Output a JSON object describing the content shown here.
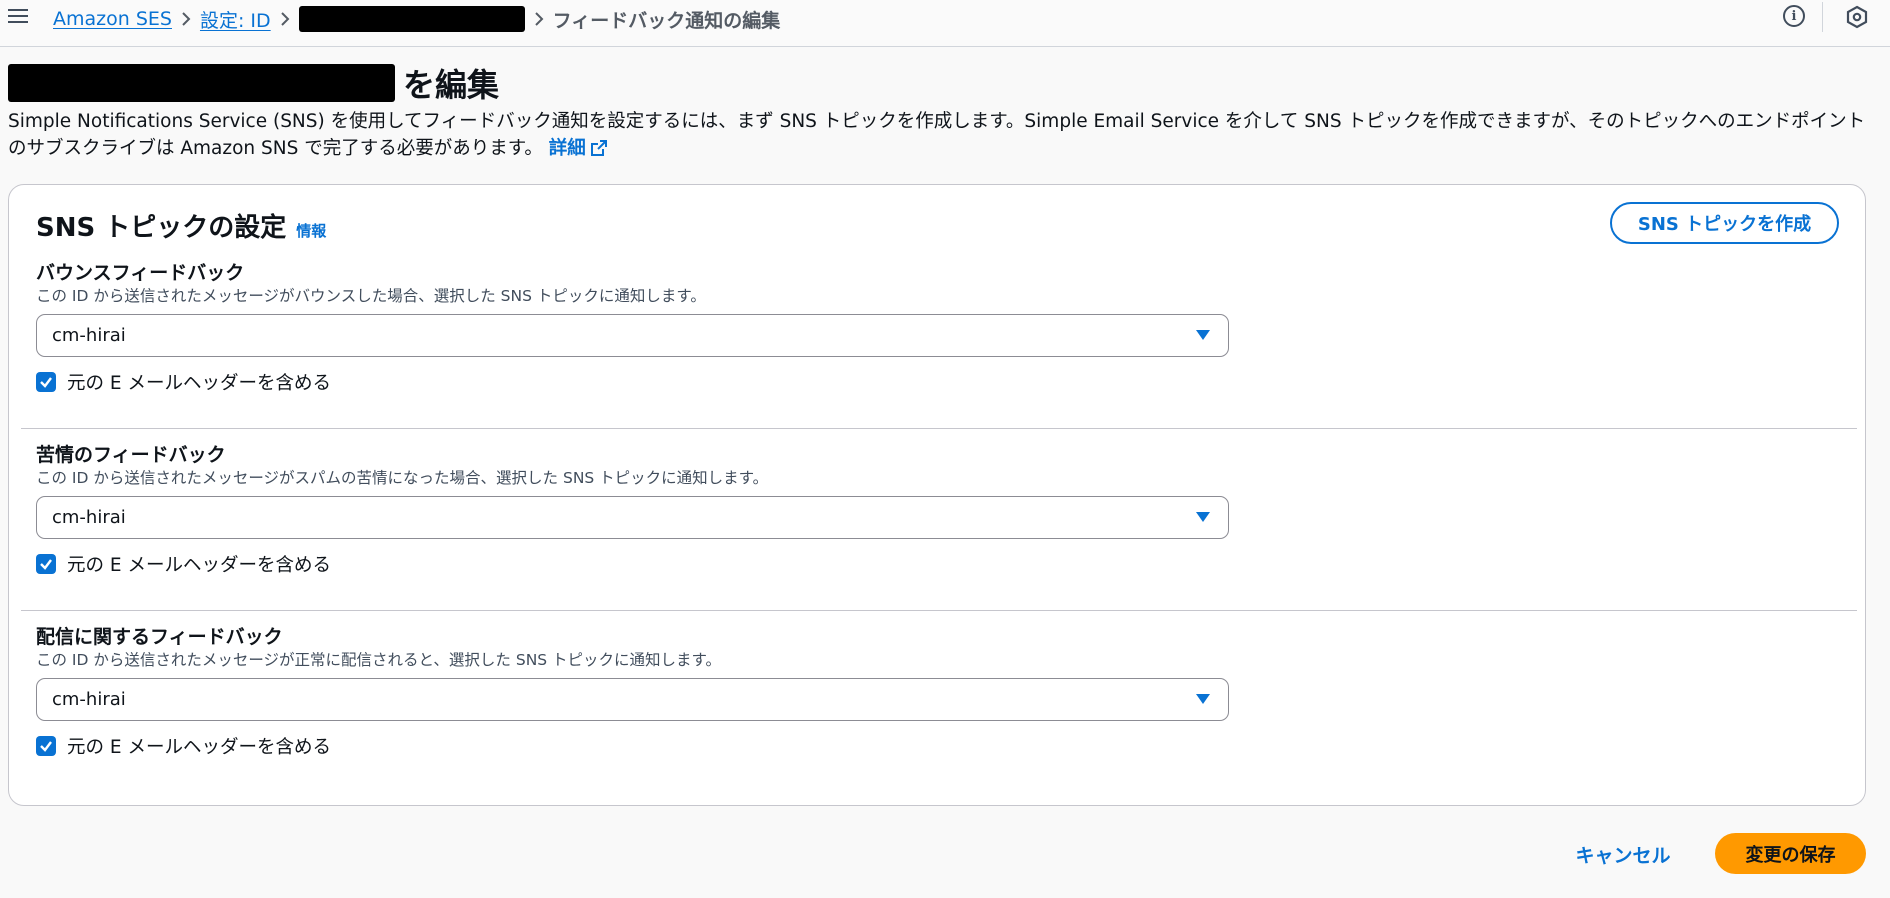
{
  "breadcrumb": {
    "items": [
      {
        "label": "Amazon SES"
      },
      {
        "label": "設定: ID"
      },
      {
        "label": ""
      }
    ],
    "current": "フィードバック通知の編集"
  },
  "header": {
    "title_suffix": "を編集",
    "description": "Simple Notifications Service (SNS) を使用してフィードバック通知を設定するには、まず SNS トピックを作成します。Simple Email Service を介して SNS トピックを作成できますが、そのトピックへのエンドポイントのサブスクライブは Amazon SNS で完了する必要があります。",
    "learn_more": "詳細"
  },
  "card": {
    "title": "SNS トピックの設定",
    "info_link": "情報",
    "create_button": "SNS トピックを作成",
    "sections": [
      {
        "label": "バウンスフィードバック",
        "description": "この ID から送信されたメッセージがバウンスした場合、選択した SNS トピックに通知します。",
        "selected": "cm-hirai",
        "checkbox_label": "元の E メールヘッダーを含める",
        "checked": true
      },
      {
        "label": "苦情のフィードバック",
        "description": "この ID から送信されたメッセージがスパムの苦情になった場合、選択した SNS トピックに通知します。",
        "selected": "cm-hirai",
        "checkbox_label": "元の E メールヘッダーを含める",
        "checked": true
      },
      {
        "label": "配信に関するフィードバック",
        "description": "この ID から送信されたメッセージが正常に配信されると、選択した SNS トピックに通知します。",
        "selected": "cm-hirai",
        "checkbox_label": "元の E メールヘッダーを含める",
        "checked": true
      }
    ]
  },
  "actions": {
    "cancel": "キャンセル",
    "save": "変更の保存"
  },
  "colors": {
    "link": "#0972d3",
    "primary_button": "#ff9900",
    "text": "#0f141a"
  }
}
